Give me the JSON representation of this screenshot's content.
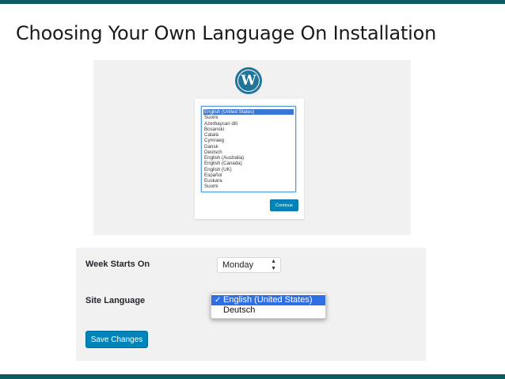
{
  "slide": {
    "title": "Choosing Your Own Language On Installation"
  },
  "installer": {
    "logo_letter": "W",
    "languages": [
      "English (United States)",
      "Suomi",
      "Azerbaycan dili",
      "Bosanski",
      "Català",
      "Cymraeg",
      "Dansk",
      "Deutsch",
      "English (Australia)",
      "English (Canada)",
      "English (UK)",
      "Español",
      "Euskara",
      "Suomi"
    ],
    "continue_label": "Continue"
  },
  "settings": {
    "week_starts_label": "Week Starts On",
    "week_starts_value": "Monday",
    "site_language_label": "Site Language",
    "language_options": [
      "English (United States)",
      "Deutsch"
    ],
    "save_label": "Save Changes"
  },
  "colors": {
    "accent_bar": "#0d5a63",
    "wp_blue": "#21759b",
    "button_blue": "#0085ba",
    "select_highlight": "#2f6fe6"
  }
}
